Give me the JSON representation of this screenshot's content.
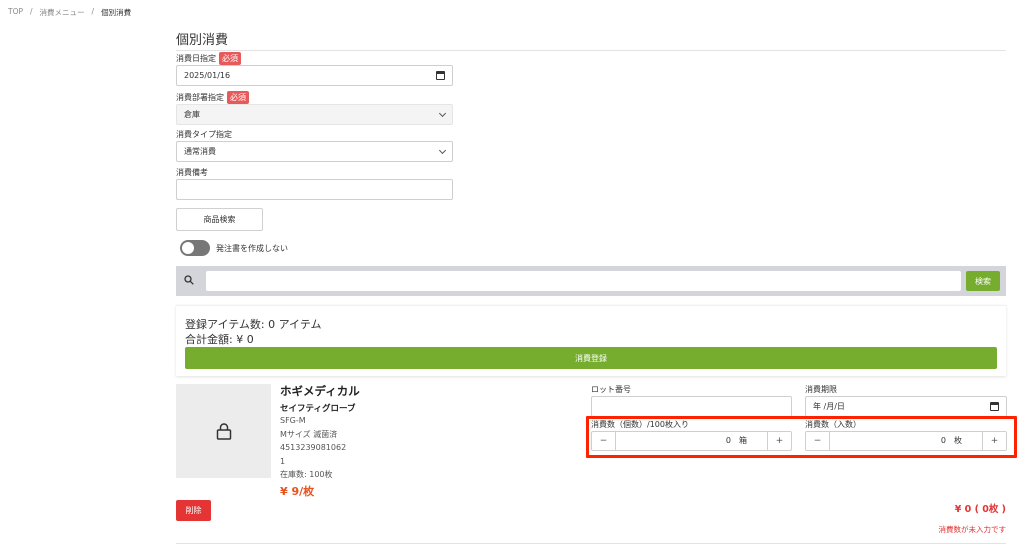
{
  "breadcrumb": {
    "items": [
      "TOP",
      "消費メニュー",
      "個別消費"
    ],
    "separator": "/"
  },
  "page": {
    "title": "個別消費"
  },
  "form": {
    "date_label": "消費日指定",
    "required_badge": "必須",
    "date_value": "2025/01/16",
    "department_label": "消費部署指定",
    "department_value": "倉庫",
    "type_label": "消費タイプ指定",
    "type_value": "通常消費",
    "note_label": "消費備考",
    "note_value": ""
  },
  "product_search_button": "商品検索",
  "toggle": {
    "label": "発注書を作成しない",
    "on": false
  },
  "search": {
    "placeholder": "",
    "button": "検索"
  },
  "summary": {
    "items_count": "登録アイテム数: 0 アイテム",
    "total_amount": "合計金額: ¥ 0",
    "register_button": "消費登録"
  },
  "product": {
    "maker": "ホギメディカル",
    "name": "セイフティグローブ",
    "code": "SFG-M",
    "spec": "Mサイズ 滅菌済",
    "jan": "4513239081062",
    "qty": "1",
    "stock": "在庫数: 100枚",
    "price": "¥ 9/枚",
    "lot_label": "ロット番号",
    "lot_value": "",
    "expiry_label": "消費期限",
    "expiry_placeholder": "年 /月/日",
    "qty_box_label": "消費数（個数）/100枚入り",
    "qty_box_value": "0",
    "qty_box_unit": "箱",
    "qty_piece_label": "消費数（入数）",
    "qty_piece_value": "0",
    "qty_piece_unit": "枚",
    "minus": "−",
    "plus": "+",
    "delete_button": "削除",
    "total": "¥ 0 ( 0枚 )",
    "warning": "消費数が未入力です"
  },
  "colors": {
    "accent_green": "#77ad2f",
    "danger_red": "#e43434",
    "highlight_red": "#ff2200",
    "price_orange": "#e8511f"
  },
  "icons": [
    "calendar-icon",
    "chevron-down-icon",
    "search-icon",
    "lock-icon"
  ]
}
